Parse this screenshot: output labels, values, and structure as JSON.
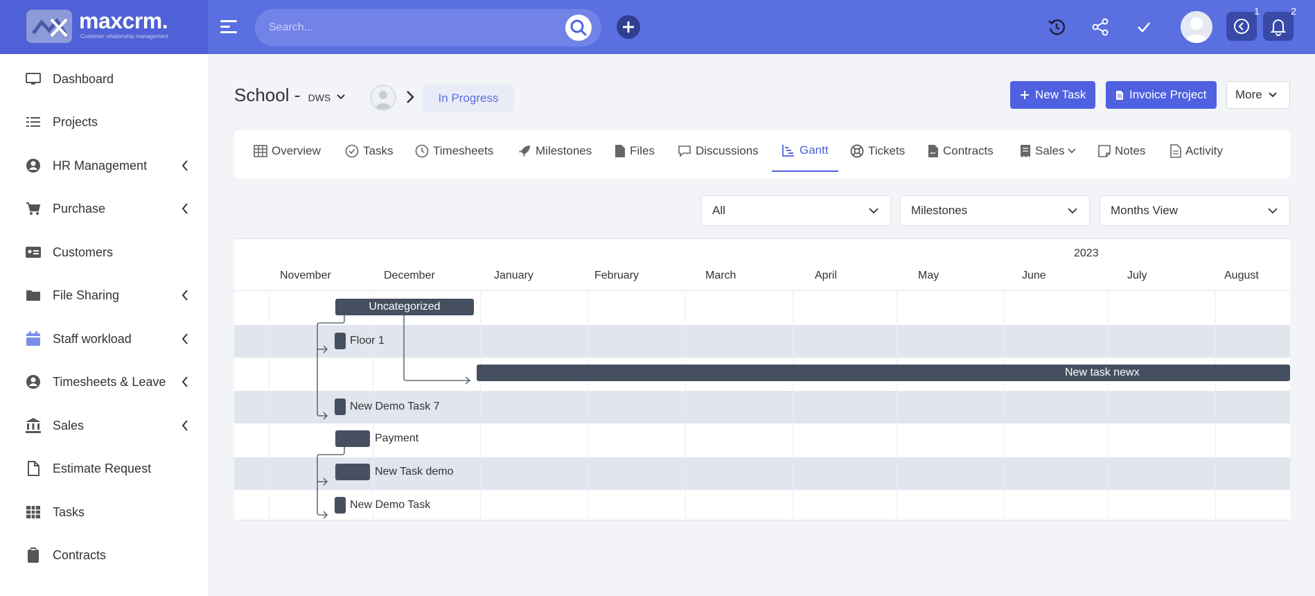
{
  "app": {
    "name": "maxcrm.",
    "tagline": "Customer relationship management"
  },
  "header": {
    "search_placeholder": "Search...",
    "timers_badge": "1",
    "notifications_badge": "2"
  },
  "sidebar": {
    "items": [
      {
        "label": "Dashboard",
        "icon": "monitor-icon",
        "has_submenu": false
      },
      {
        "label": "Projects",
        "icon": "list-icon",
        "has_submenu": false
      },
      {
        "label": "HR Management",
        "icon": "user-circle-icon",
        "has_submenu": true
      },
      {
        "label": "Purchase",
        "icon": "cart-icon",
        "has_submenu": true
      },
      {
        "label": "Customers",
        "icon": "id-card-icon",
        "has_submenu": false
      },
      {
        "label": "File Sharing",
        "icon": "folder-icon",
        "has_submenu": true
      },
      {
        "label": "Staff workload",
        "icon": "calendar-icon",
        "has_submenu": true
      },
      {
        "label": "Timesheets & Leave",
        "icon": "user-circle-icon",
        "has_submenu": true
      },
      {
        "label": "Sales",
        "icon": "bank-icon",
        "has_submenu": true
      },
      {
        "label": "Estimate Request",
        "icon": "file-icon",
        "has_submenu": false
      },
      {
        "label": "Tasks",
        "icon": "table-icon",
        "has_submenu": false
      },
      {
        "label": "Contracts",
        "icon": "clipboard-icon",
        "has_submenu": false
      }
    ]
  },
  "project": {
    "title": "School - ",
    "code": "DWS",
    "status": "In Progress"
  },
  "actions": {
    "new_task": "New Task",
    "invoice_project": "Invoice Project",
    "more": "More"
  },
  "tabs": [
    {
      "label": "Overview",
      "icon": "table-icon"
    },
    {
      "label": "Tasks",
      "icon": "check-circle-icon"
    },
    {
      "label": "Timesheets",
      "icon": "clock-icon"
    },
    {
      "label": "Milestones",
      "icon": "rocket-icon"
    },
    {
      "label": "Files",
      "icon": "file-icon"
    },
    {
      "label": "Discussions",
      "icon": "comment-icon"
    },
    {
      "label": "Gantt",
      "icon": "gantt-icon",
      "active": true
    },
    {
      "label": "Tickets",
      "icon": "lifebuoy-icon"
    },
    {
      "label": "Contracts",
      "icon": "contract-icon"
    },
    {
      "label": "Sales",
      "icon": "receipt-icon",
      "dropdown": true
    },
    {
      "label": "Notes",
      "icon": "note-icon"
    },
    {
      "label": "Activity",
      "icon": "document-icon"
    }
  ],
  "filters": {
    "type": "All",
    "group_by": "Milestones",
    "view": "Months View"
  },
  "gantt": {
    "year": "2023",
    "months": [
      "November",
      "December",
      "January",
      "February",
      "March",
      "April",
      "May",
      "June",
      "July",
      "August"
    ],
    "rows": [
      {
        "label": "Uncategorized",
        "kind": "group"
      },
      {
        "label": "Floor 1",
        "kind": "task"
      },
      {
        "label": "New task newx",
        "kind": "task"
      },
      {
        "label": "New Demo Task 7",
        "kind": "task"
      },
      {
        "label": "Payment",
        "kind": "group"
      },
      {
        "label": "New Task demo",
        "kind": "task"
      },
      {
        "label": "New Demo Task",
        "kind": "task"
      }
    ]
  },
  "colors": {
    "header": "#5a6fe0",
    "primary": "#4f61e0",
    "bar": "#454f5f",
    "row_band": "#e1e5ee"
  }
}
